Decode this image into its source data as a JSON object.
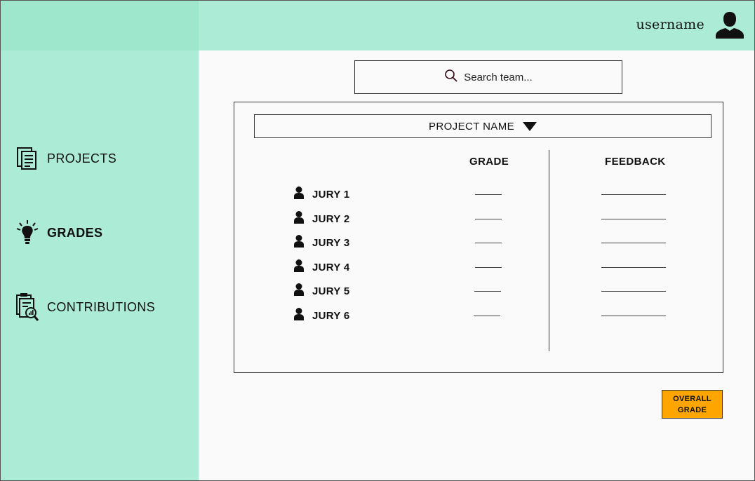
{
  "header": {
    "username": "username"
  },
  "sidebar": {
    "items": [
      {
        "label": "PROJECTS",
        "icon": "documents-icon",
        "active": false
      },
      {
        "label": "GRADES",
        "icon": "lightbulb-icon",
        "active": true
      },
      {
        "label": "CONTRIBUTIONS",
        "icon": "clipboard-search-icon",
        "active": false
      }
    ]
  },
  "search": {
    "placeholder": "Search team..."
  },
  "panel": {
    "project_select": "PROJECT NAME",
    "columns": {
      "grade": "GRADE",
      "feedback": "FEEDBACK"
    },
    "rows": [
      {
        "label": "JURY 1"
      },
      {
        "label": "JURY 2"
      },
      {
        "label": "JURY 3"
      },
      {
        "label": "JURY 4"
      },
      {
        "label": "JURY 5"
      },
      {
        "label": "JURY 6"
      }
    ]
  },
  "overall_button": "OVERALL GRADE",
  "colors": {
    "sidebar": "#acebd5",
    "sidebar_top": "#9ee6cc",
    "accent_button": "#ffa500",
    "background": "#fafafa"
  }
}
